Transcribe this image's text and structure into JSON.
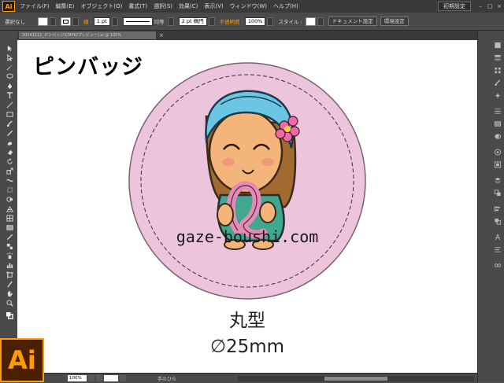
{
  "app": {
    "logo_text": "Ai",
    "menu": [
      "ファイル(F)",
      "編集(E)",
      "オブジェクト(O)",
      "書式(T)",
      "選択(S)",
      "効果(C)",
      "表示(V)",
      "ウィンドウ(W)",
      "ヘルプ(H)"
    ],
    "workspace": "初期設定"
  },
  "controlbar": {
    "selection_label": "選択なし",
    "stroke_label": "線 :",
    "stroke_width": "1 pt",
    "line_style": "均等",
    "brush": "2 pt 楕円",
    "opacity_label": "不透明度 :",
    "opacity_value": "100%",
    "style_label": "スタイル :",
    "doc_settings_button": "ドキュメント設定",
    "env_settings_button": "環境設定"
  },
  "document": {
    "tab_title": "20141111_ピンバッジ(CMYK/プレビュー).ai @ 100%",
    "title": "ピンバッジ",
    "domain": "gaze-boushi.com",
    "shape_name": "丸型",
    "size": "∅25mm"
  },
  "statusbar": {
    "zoom": "100%",
    "tool_name": "手のひら"
  },
  "colors": {
    "badge_fill": "#ecc4dc",
    "accent": "#ff9a00",
    "panel_bg": "#4a4a4a"
  },
  "icons": {
    "logo": "illustrator-logo-icon"
  }
}
